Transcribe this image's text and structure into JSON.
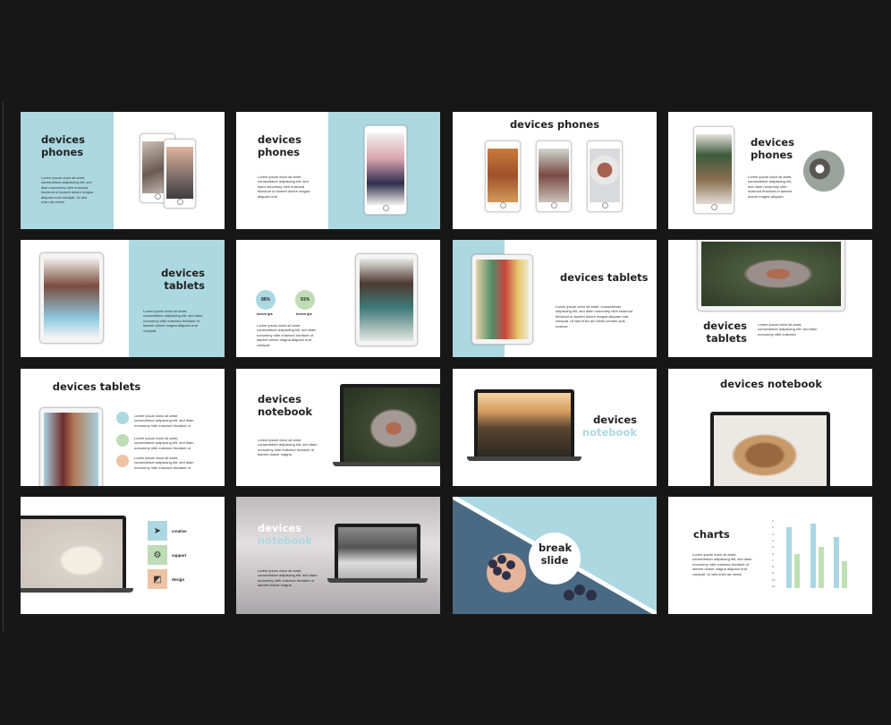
{
  "colors": {
    "background": "#171717",
    "accent_blue": "#acd8e1",
    "accent_green": "#bedcb5",
    "accent_peach": "#f0c2a4",
    "bar_blue": "#a9d6e3",
    "bar_green": "#bfe0b5"
  },
  "slides": [
    {
      "title": "devices phones",
      "body": "Lorem ipsum dolor sit amet, consectetuer adipiscing elit, sed diam nonummy nibh euismod tincidunt ut laoreet dolore magna aliquam erat volutpat. Ut wisi enim ad minim"
    },
    {
      "title": "devices phones",
      "body": "Lorem ipsum dolor sit amet, consectetuer adipiscing elit, sed diam nonummy nibh euismod tincidunt ut laoreet dolore magna aliquam erat"
    },
    {
      "title": "devices phones"
    },
    {
      "title": "devices phones",
      "body": "Lorem ipsum dolor sit amet, consectetuer adipiscing elit, sed diam nonummy nibh euismod tincidunt ut laoreet dolore magna aliquam"
    },
    {
      "title": "devices tablets",
      "body": "Lorem ipsum dolor sit amet, consectetuer adipiscing elit, sed diam nonummy nibh euismod tincidunt ut laoreet dolore magna aliquam erat volutpat."
    },
    {
      "stats": [
        {
          "value": "86%",
          "label": "lorem ips"
        },
        {
          "value": "91%",
          "label": "lorem ips"
        }
      ],
      "body": "Lorem ipsum dolor sit amet, consectetuer adipiscing elit, sed diam nonummy nibh euismod tincidunt ut laoreet dolore magna aliquam erat volutpat."
    },
    {
      "title": "devices tablets",
      "body": "Lorem ipsum dolor sit amet, consectetuer adipiscing elit, sed diam nonummy nibh euismod tincidunt ut laoreet dolore magna aliquam erat volutpat. Ut wisi enim ad minim veniam quis nostrud."
    },
    {
      "title": "devices tablets",
      "body": "Lorem ipsum dolor sit amet, consectetuer adipiscing elit, sed diam nonummy nibh euismod"
    },
    {
      "title": "devices tablets",
      "items": [
        {
          "icon": "lightbulb-icon",
          "text": "Lorem ipsum dolor sit amet, consectetuer adipiscing elit, sed diam nonummy nibh euismod tincidunt ut"
        },
        {
          "icon": "tag-icon",
          "text": "Lorem ipsum dolor sit amet, consectetuer adipiscing elit, sed diam nonummy nibh euismod tincidunt ut"
        },
        {
          "icon": "timer-icon",
          "text": "Lorem ipsum dolor sit amet, consectetuer adipiscing elit, sed diam nonummy nibh euismod tincidunt ut"
        }
      ]
    },
    {
      "title": "devices notebook",
      "body": "Lorem ipsum dolor sit amet, consectetuer adipiscing elit, sed diam nonummy nibh euismod tincidunt ut laoreet dolore magna"
    },
    {
      "title_line1": "devices",
      "title_line2": "notebook"
    },
    {
      "title": "devices notebook"
    },
    {
      "features": [
        {
          "icon": "paper-plane-icon",
          "label": "creative"
        },
        {
          "icon": "gear-icon",
          "label": "support"
        },
        {
          "icon": "layers-icon",
          "label": "design"
        }
      ]
    },
    {
      "title_line1": "devices",
      "title_line2": "notebook",
      "body": "Lorem ipsum dolor sit amet, consectetuer adipiscing elit, sed diam nonummy nibh euismod tincidunt ut laoreet dolore magna"
    },
    {
      "title": "break slide"
    },
    {
      "title": "charts",
      "body": "Lorem ipsum dolor sit amet, consectetuer adipiscing elit, sed diam nonummy nibh euismod tincidunt ut laoreet dolore magna aliquam erat volutpat. Ut wisi enim ad minim"
    }
  ],
  "chart_data": {
    "type": "bar",
    "categories": [
      "1",
      "2",
      "3"
    ],
    "series": [
      {
        "values": [
          90,
          95,
          75
        ]
      },
      {
        "values": [
          50,
          60,
          40
        ]
      }
    ],
    "ylim": [
      0,
      100
    ],
    "xlabel": "",
    "ylabel": "",
    "ticks": [
      "1",
      "2",
      "3",
      "4",
      "5",
      "6",
      "7",
      "8",
      "9",
      "10",
      "11"
    ]
  }
}
